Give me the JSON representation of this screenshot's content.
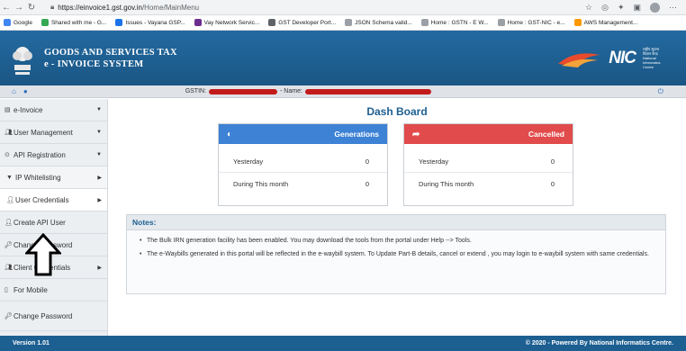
{
  "browser": {
    "url_domain": "https://einvoice1.gst.gov.in",
    "url_path": "/Home/MainMenu",
    "bookmarks": [
      {
        "label": "Google",
        "color": "#4285f4"
      },
      {
        "label": "Shared with me - G...",
        "color": "#34a853"
      },
      {
        "label": "Issues - Vayana GSP...",
        "color": "#1a73e8"
      },
      {
        "label": "Vay Network Servic...",
        "color": "#6b2d8f"
      },
      {
        "label": "GST Developer Port...",
        "color": "#5f6368"
      },
      {
        "label": "JSON Schema valid...",
        "color": "#9aa0a6"
      },
      {
        "label": "Home : GSTN - E W...",
        "color": "#9aa0a6"
      },
      {
        "label": "Home : GST-NIC - e...",
        "color": "#9aa0a6"
      },
      {
        "label": "AWS Management...",
        "color": "#ff9900"
      }
    ]
  },
  "header": {
    "title_line1": "GOODS AND SERVICES TAX",
    "title_line2": "e - INVOICE SYSTEM",
    "nic_logo": "NIC",
    "nic_subtitle": "राष्ट्रीय सूचना विज्ञान केन्द्र National Informatics Centre",
    "brand_color": "#1d5f91"
  },
  "info_strip": {
    "gstin_label": "GSTIN:",
    "name_label": "- Name:"
  },
  "sidebar": {
    "items": [
      {
        "label": "e-Invoice",
        "icon": "file-icon"
      },
      {
        "label": "User Management",
        "icon": "users-icon"
      },
      {
        "label": "API Registration",
        "icon": "link-icon"
      },
      {
        "label": "IP Whitelisting",
        "icon": "filter-icon"
      },
      {
        "label": "User Credentials",
        "icon": "user-icon"
      },
      {
        "label": "Create API User",
        "icon": "user-plus-icon"
      },
      {
        "label": "Change Password",
        "icon": "key-icon"
      },
      {
        "label": "Client Credentials",
        "icon": "users-icon"
      },
      {
        "label": "For Mobile",
        "icon": "mobile-icon"
      },
      {
        "label": "Change Password",
        "icon": "key-icon"
      }
    ]
  },
  "dashboard": {
    "title": "Dash Board",
    "generations": {
      "label": "Generations",
      "color": "#3d82d4",
      "rows": [
        {
          "label": "Yesterday",
          "value": "0"
        },
        {
          "label": "During This month",
          "value": "0"
        }
      ]
    },
    "cancelled": {
      "label": "Cancelled",
      "color": "#e24b4b",
      "rows": [
        {
          "label": "Yesterday",
          "value": "0"
        },
        {
          "label": "During This month",
          "value": "0"
        }
      ]
    }
  },
  "notes": {
    "title": "Notes:",
    "items": [
      "The Bulk IRN generation facility has been enabled. You may download the tools from the portal under Help --> Tools.",
      "The e-Waybills generated in this portal will be reflected in the e-waybill system. To Update Part-B details, cancel or extend , you may login to e-waybill system with same credentials."
    ]
  },
  "footer": {
    "version": "Version 1.01",
    "copyright": "© 2020 - Powered By National Informatics Centre."
  }
}
